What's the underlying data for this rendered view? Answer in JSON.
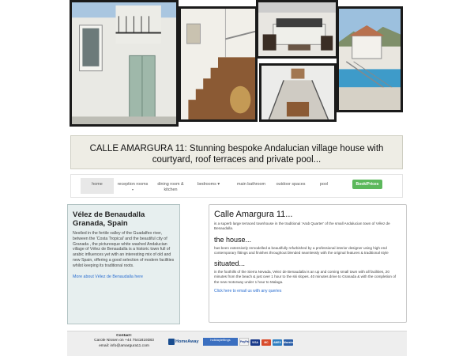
{
  "collage": {
    "photos": [
      "house-exterior-photo",
      "staircase-photo",
      "roof-terrace-lounge-photo",
      "stairwell-photo",
      "pool-terrace-photo"
    ]
  },
  "banner": {
    "title": "CALLE AMARGURA 11: Stunning bespoke Andalucian village house with courtyard, roof terraces and private pool..."
  },
  "nav": {
    "items": [
      {
        "label": "home",
        "active": true,
        "dropdown": false
      },
      {
        "label": "reception rooms",
        "active": false,
        "dropdown": true
      },
      {
        "label": "dining room & kitchen",
        "active": false,
        "dropdown": false
      },
      {
        "label": "bedrooms",
        "active": false,
        "dropdown": true
      },
      {
        "label": "main bathroom",
        "active": false,
        "dropdown": false
      },
      {
        "label": "outdoor spaces",
        "active": false,
        "dropdown": false
      },
      {
        "label": "pool",
        "active": false,
        "dropdown": false
      }
    ],
    "book_label": "Book/Prices",
    "caret": "▾"
  },
  "left": {
    "title": "Vélez de Benaudalla Granada, Spain",
    "text": "Nestled in the fertile valley of the Guadalfeo river, between the 'Costa Tropical' and the beautiful city of Granada , the picturesque white washed Andalucian village of Vélez de Benaudalla is a historic town full of arabic influences yet with an interesting mix of old and new Spain, offering a good selection of modern facilities whilst keeping its traditional roots.",
    "link": "More about Vélez de Benaudalla here"
  },
  "right": {
    "title": "Calle Amargura 11...",
    "intro": "is a superb large terraced townhouse in the traditional 'Arab Quarter' of the small Andalucian town of Vélez de Benaudalla.",
    "house_heading": "the house...",
    "house_text": "has been extensively remodelled & beautifully refurbished by a professional interior designer using high end contemporary fittings and finishes throughout blended seamlessly with the original features & traditional style",
    "situated_heading": "situated...",
    "situated_text": "in the foothills of the Sierra Nevada, Velez de Benaudalla is an up and coming small town with all facilities, 20 minutes from the beach & just over 1 hour to the ski slopes. 40 minutes drive to Granada & with the completion of the new motorway under 1 hour to Malaga.",
    "link": "Click here to email us with any queries"
  },
  "footer": {
    "contact_label": "Contact:",
    "phone_line": "Carole Nissen on +44 7541819383",
    "email_line": "email: info@amargura11.com",
    "homeaway": "HomeAway",
    "holidaylettings": "holidaylettings",
    "paypal": "PayPal",
    "cards": [
      "VISA",
      "MC",
      "AMEX",
      "Maestro"
    ]
  }
}
